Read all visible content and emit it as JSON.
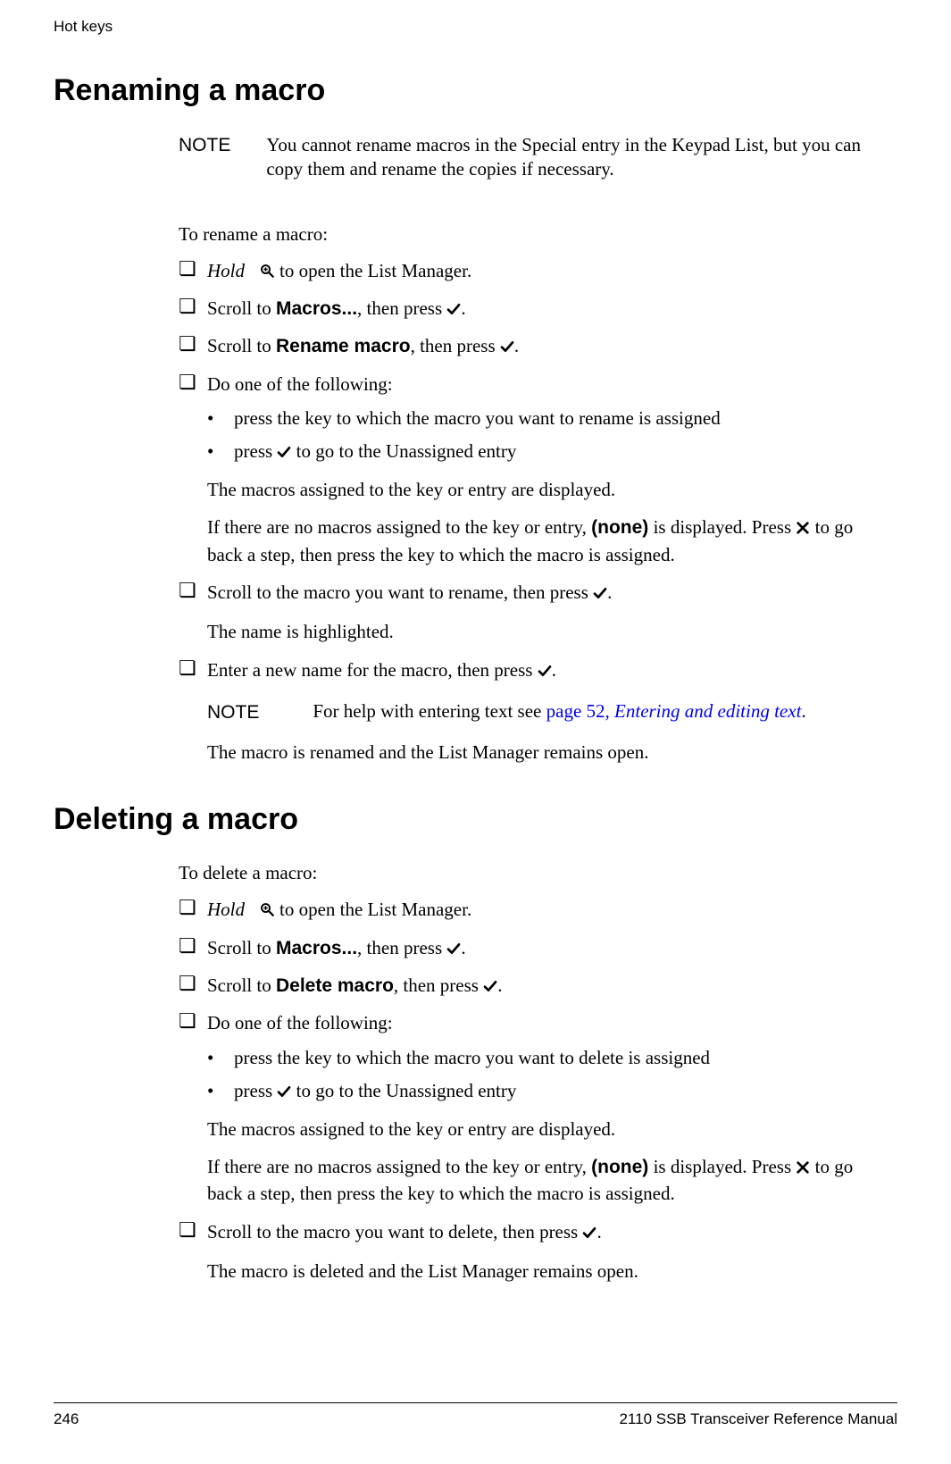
{
  "running_header": "Hot keys",
  "section_a": {
    "title": "Renaming a macro",
    "note_label": "NOTE",
    "note_text": "You cannot rename macros in the Special entry in the Keypad List, but you can copy them and rename the copies if necessary.",
    "intro": "To rename a macro:",
    "step1_prefix": "Hold",
    "step1_suffix": " to open the List Manager.",
    "step2_pre": "Scroll to ",
    "step2_bold": "Macros...",
    "step2_mid": ", then press ",
    "step2_end": ".",
    "step3_pre": "Scroll to ",
    "step3_bold": "Rename macro",
    "step3_mid": ", then press ",
    "step3_end": ".",
    "step4": "Do one of the following:",
    "step4_b1": "press the key to which the macro you want to rename is assigned",
    "step4_b2_pre": "press ",
    "step4_b2_post": " to go to the Unassigned entry",
    "step4_para1": "The macros assigned to the key or entry are displayed.",
    "step4_para2_pre": "If there are no macros assigned to the key or entry, ",
    "step4_para2_bold": "(none)",
    "step4_para2_mid": " is displayed. Press ",
    "step4_para2_post": " to go back a step, then press the key to which the macro is assigned.",
    "step5_pre": "Scroll to the macro you want to rename, then press ",
    "step5_end": ".",
    "step5_para": "The name is highlighted.",
    "step6_pre": "Enter a new name for the macro, then press ",
    "step6_end": ".",
    "inner_note_label": "NOTE",
    "inner_note_pre": "For help with entering text see ",
    "inner_note_link_page": "page 52, ",
    "inner_note_link_title": "Entering and editing text",
    "inner_note_post": ".",
    "final_para": "The macro is renamed and the List Manager remains open."
  },
  "section_b": {
    "title": "Deleting a macro",
    "intro": "To delete a macro:",
    "step1_prefix": "Hold",
    "step1_suffix": " to open the List Manager.",
    "step2_pre": "Scroll to ",
    "step2_bold": "Macros...",
    "step2_mid": ", then press ",
    "step2_end": ".",
    "step3_pre": "Scroll to ",
    "step3_bold": "Delete macro",
    "step3_mid": ", then press ",
    "step3_end": ".",
    "step4": "Do one of the following:",
    "step4_b1": "press the key to which the macro you want to delete is assigned",
    "step4_b2_pre": "press ",
    "step4_b2_post": " to go to the Unassigned entry",
    "step4_para1": "The macros assigned to the key or entry are displayed.",
    "step4_para2_pre": "If there are no macros assigned to the key or entry, ",
    "step4_para2_bold": "(none)",
    "step4_para2_mid": " is displayed. Press ",
    "step4_para2_post": " to go back a step, then press the key to which the macro is assigned.",
    "step5_pre": "Scroll to the macro you want to delete, then press ",
    "step5_end": ".",
    "final_para": "The macro is deleted and the List Manager remains open."
  },
  "footer": {
    "page_num": "246",
    "doc_title": "2110 SSB Transceiver Reference Manual"
  },
  "glyphs": {
    "checkbox": "❏",
    "bullet": "•"
  }
}
